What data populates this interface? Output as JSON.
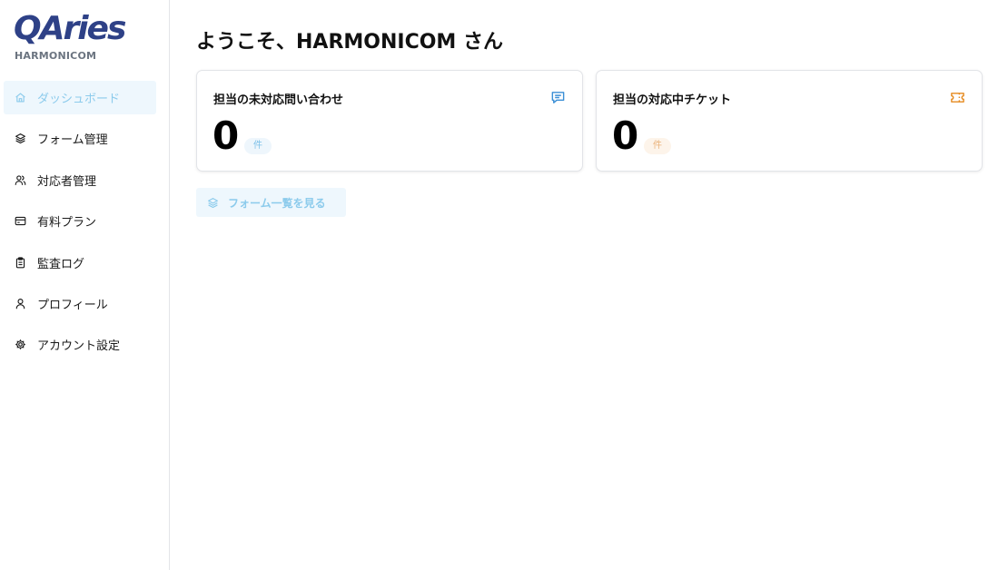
{
  "brand": {
    "logo": "QAries",
    "org": "HARMONICOM",
    "logo_color": "#2e4187"
  },
  "sidebar": {
    "items": [
      {
        "label": "ダッシュボード",
        "icon": "home-icon",
        "active": true
      },
      {
        "label": "フォーム管理",
        "icon": "layers-icon",
        "active": false
      },
      {
        "label": "対応者管理",
        "icon": "users-icon",
        "active": false
      },
      {
        "label": "有料プラン",
        "icon": "credit-card-icon",
        "active": false
      },
      {
        "label": "監査ログ",
        "icon": "clipboard-icon",
        "active": false
      },
      {
        "label": "プロフィール",
        "icon": "user-icon",
        "active": false
      },
      {
        "label": "アカウント設定",
        "icon": "gear-icon",
        "active": false
      }
    ]
  },
  "main": {
    "welcome": "ようこそ、HARMONICOM さん",
    "cards": [
      {
        "title": "担当の未対応問い合わせ",
        "value": "0",
        "unit": "件",
        "icon": "message-icon",
        "accent": "#3b8fd6"
      },
      {
        "title": "担当の対応中チケット",
        "value": "0",
        "unit": "件",
        "icon": "ticket-icon",
        "accent": "#e58a1f"
      }
    ],
    "forms_button": "フォーム一覧を見る"
  }
}
